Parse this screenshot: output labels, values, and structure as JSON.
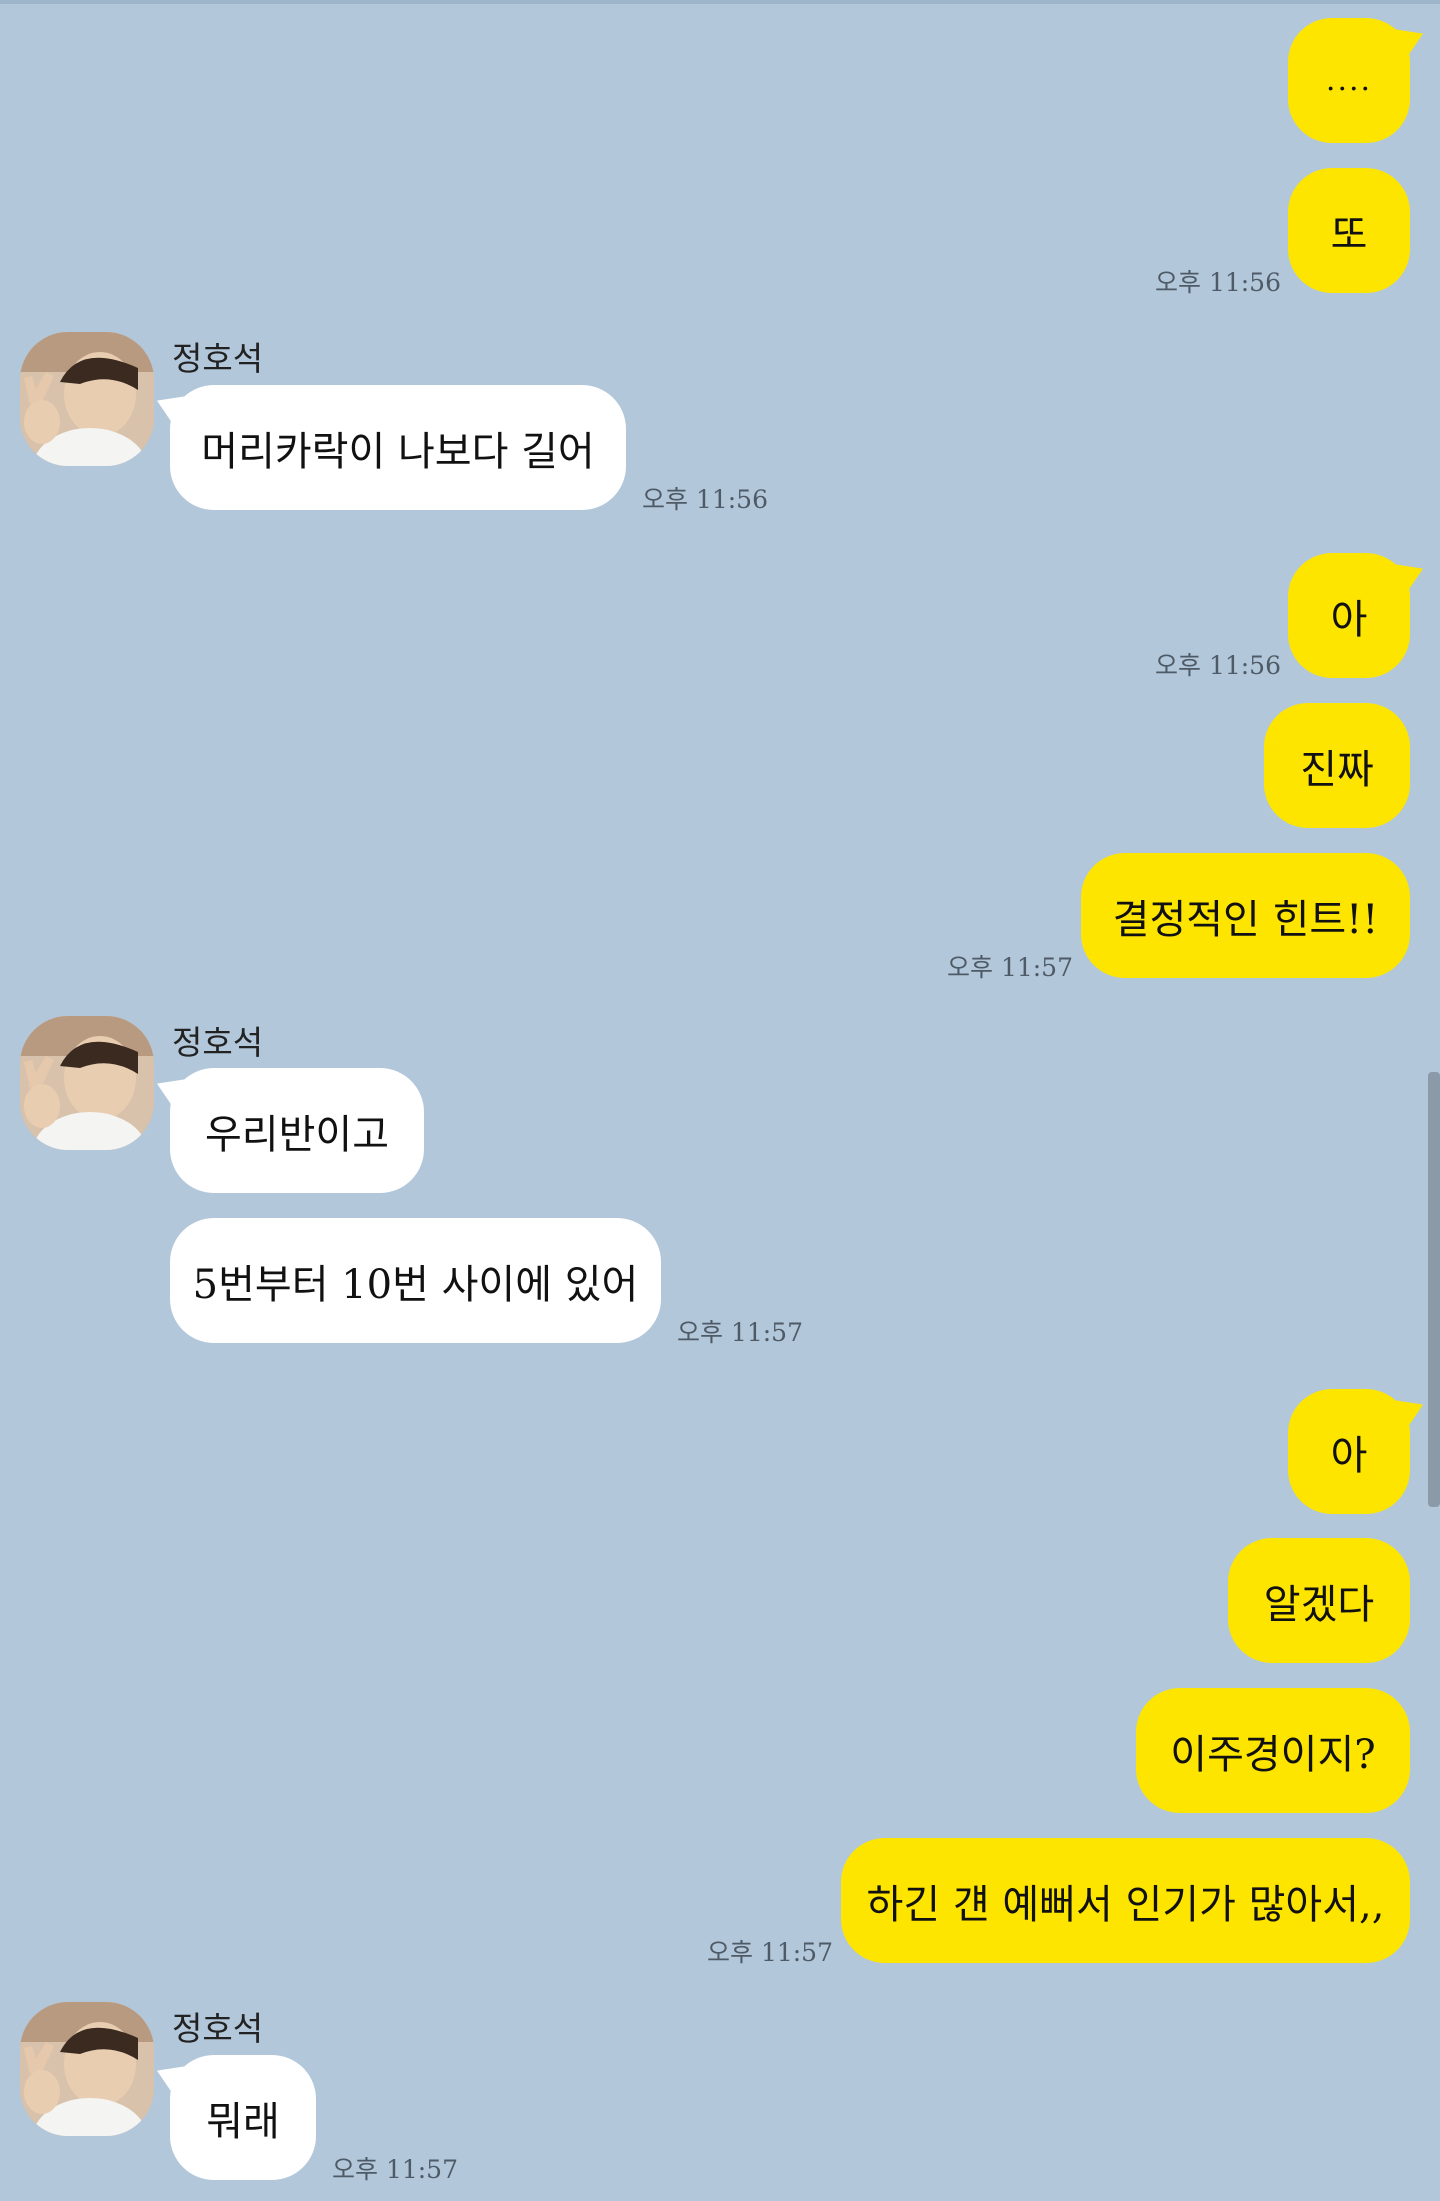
{
  "contact": {
    "name": "정호석"
  },
  "messages": {
    "m1": "....",
    "m2": "또",
    "t1": "오후 11:56",
    "r1": "머리카락이 나보다 길어",
    "rt1": "오후 11:56",
    "m3": "아",
    "t2": "오후 11:56",
    "m4": "진짜",
    "m5": "결정적인 힌트!!",
    "t3": "오후 11:57",
    "r2": "우리반이고",
    "r3": "5번부터 10번 사이에 있어",
    "rt2": "오후 11:57",
    "m6": "아",
    "m7": "알겠다",
    "m8": "이주경이지?",
    "m9": "하긴 걘 예뻐서 인기가 많아서,,",
    "t4": "오후 11:57",
    "r4": "뭐래",
    "rt3": "오후 11:57"
  },
  "colors": {
    "background": "#b2c7da",
    "my_bubble": "#fee500",
    "their_bubble": "#ffffff"
  }
}
